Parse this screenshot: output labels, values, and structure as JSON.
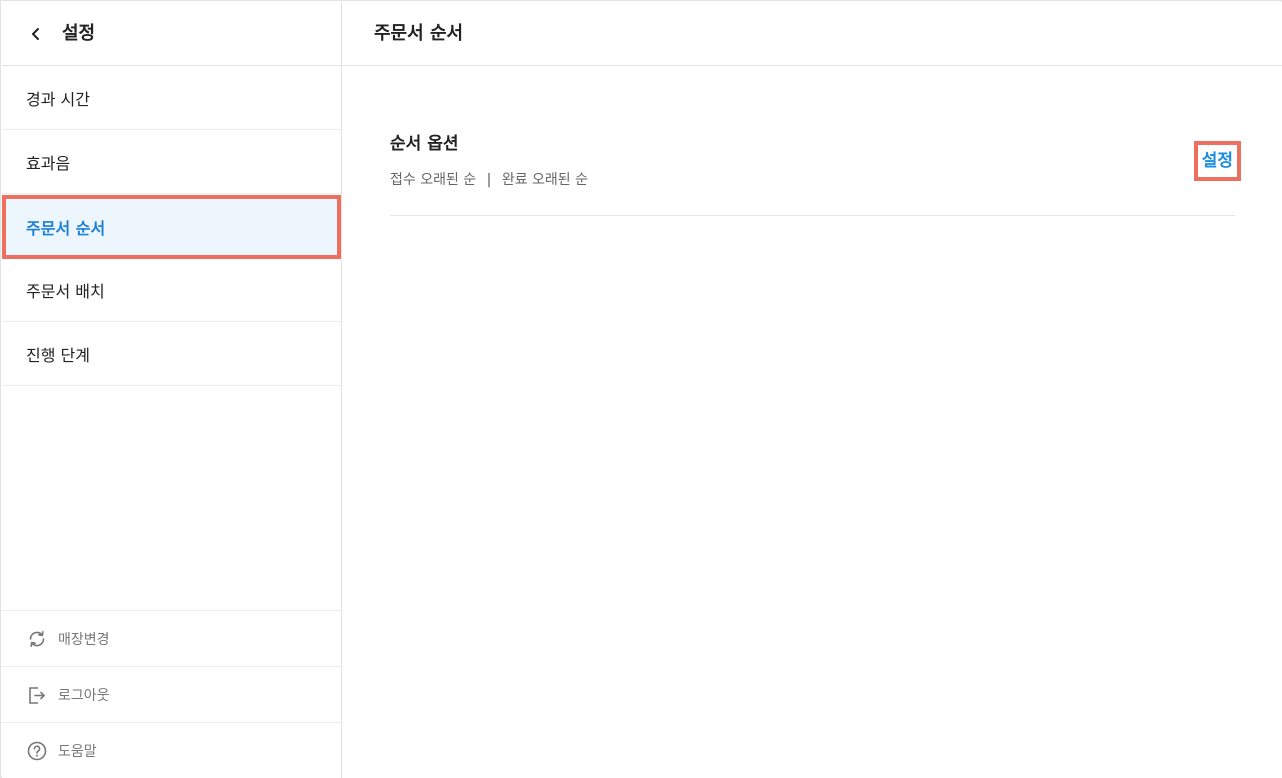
{
  "sidebar": {
    "title": "설정",
    "items": [
      {
        "label": "경과 시간"
      },
      {
        "label": "효과음"
      },
      {
        "label": "주문서 순서",
        "active": true
      },
      {
        "label": "주문서 배치"
      },
      {
        "label": "진행 단계"
      }
    ],
    "footer": [
      {
        "label": "매장변경",
        "icon": "refresh-icon"
      },
      {
        "label": "로그아웃",
        "icon": "logout-icon"
      },
      {
        "label": "도움말",
        "icon": "help-icon"
      }
    ]
  },
  "main": {
    "title": "주문서 순서",
    "option": {
      "title": "순서 옵션",
      "values": [
        "접수 오래된 순",
        "완료 오래된 순"
      ],
      "separator": "|",
      "button_label": "설정"
    }
  },
  "colors": {
    "accent": "#1a7fd6",
    "active_bg": "#eef6fd",
    "highlight_border": "#ed6f5f"
  }
}
